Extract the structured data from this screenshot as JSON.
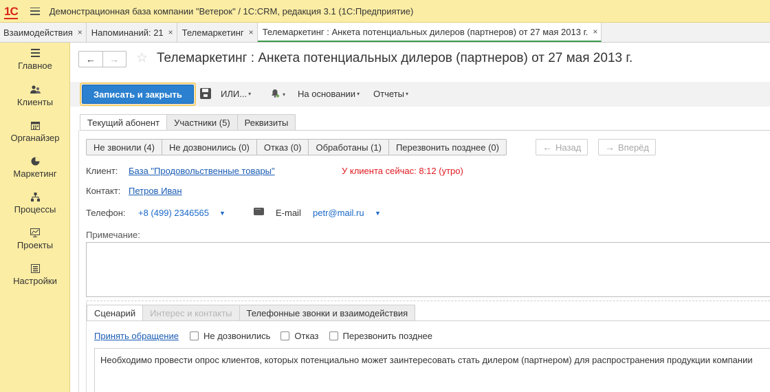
{
  "app": {
    "logo_text": "1С",
    "window_title": "Демонстрационная база компании \"Ветерок\" / 1С:CRM, редакция 3.1  (1С:Предприятие)"
  },
  "open_tabs": [
    {
      "label": "Взаимодействия",
      "close": "×"
    },
    {
      "label": "Напоминаний: 21",
      "close": "×"
    },
    {
      "label": "Телемаркетинг",
      "close": "×"
    },
    {
      "label": "Телемаркетинг : Анкета потенциальных дилеров (партнеров) от 27 мая 2013 г.",
      "close": "×",
      "active": true
    }
  ],
  "sidebar": {
    "items": [
      {
        "label": "Главное",
        "icon": "menu-lines-icon"
      },
      {
        "label": "Клиенты",
        "icon": "users-icon"
      },
      {
        "label": "Органайзер",
        "icon": "calendar-icon"
      },
      {
        "label": "Маркетинг",
        "icon": "pie-chart-icon"
      },
      {
        "label": "Процессы",
        "icon": "process-tree-icon"
      },
      {
        "label": "Проекты",
        "icon": "project-chart-icon"
      },
      {
        "label": "Настройки",
        "icon": "settings-list-icon"
      }
    ]
  },
  "form": {
    "nav_back": "←",
    "nav_forward": "→",
    "star": "☆",
    "title": "Телемаркетинг : Анкета потенциальных дилеров (партнеров) от 27 мая 2013 г."
  },
  "toolbar": {
    "save_close": "Записать и закрыть",
    "or_menu": "ИЛИ...",
    "bell": "🔔",
    "based_on": "На основании",
    "reports": "Отчеты",
    "caret": "▾"
  },
  "form_tabs": [
    "Текущий абонент",
    "Участники (5)",
    "Реквизиты"
  ],
  "filters": [
    "Не звонили (4)",
    "Не дозвонились (0)",
    "Отказ (0)",
    "Обработаны (1)",
    "Перезвонить позднее (0)"
  ],
  "nav": {
    "back": "Назад",
    "back_arrow": "←",
    "forward": "Вперёд",
    "forward_arrow": "→"
  },
  "client": {
    "label": "Клиент:",
    "value": "База \"Продовольственные товары\"",
    "time_note": "У клиента сейчас: 8:12 (утро)"
  },
  "contact": {
    "label": "Контакт:",
    "value": "Петров Иван"
  },
  "phone": {
    "label": "Телефон:",
    "value": "+8 (499) 2346565",
    "caret": "▼"
  },
  "email": {
    "label": "E-mail",
    "value": "petr@mail.ru",
    "caret": "▼"
  },
  "note": {
    "label": "Примечание:"
  },
  "script_tabs": [
    {
      "label": "Сценарий",
      "state": "active"
    },
    {
      "label": "Интерес и контакты",
      "state": "disabled"
    },
    {
      "label": "Телефонные звонки и взаимодействия",
      "state": "normal"
    }
  ],
  "script_actions": {
    "accept": "Принять обращение",
    "not_reached": "Не дозвонились",
    "refusal": "Отказ",
    "call_later": "Перезвонить позднее"
  },
  "script_text": "Необходимо провести опрос клиентов, которых потенциально может заинтересовать стать дилером (партнером) для распространения продукции компании"
}
